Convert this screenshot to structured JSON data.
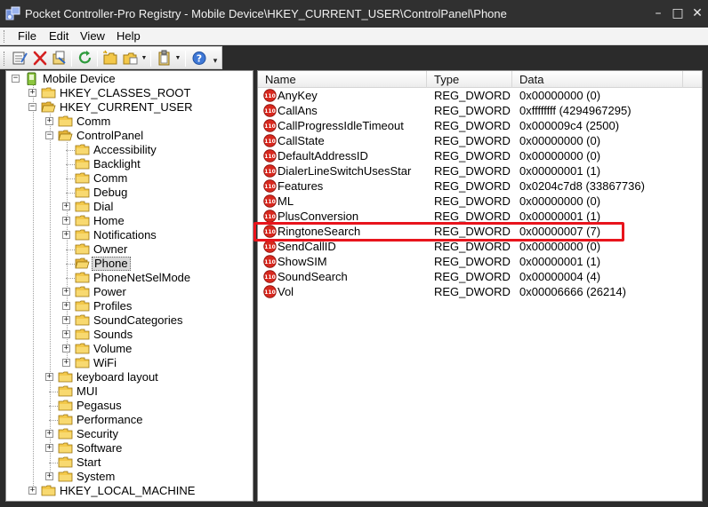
{
  "window": {
    "title": "Pocket Controller-Pro Registry - Mobile Device\\HKEY_CURRENT_USER\\ControlPanel\\Phone",
    "minimize_glyph": "–",
    "maximize_glyph": "□",
    "close_glyph": "✕"
  },
  "menu": {
    "items": [
      {
        "label": "File"
      },
      {
        "label": "Edit"
      },
      {
        "label": "View"
      },
      {
        "label": "Help"
      }
    ]
  },
  "toolbar": {
    "buttons": [
      {
        "name": "properties-icon"
      },
      {
        "name": "delete-icon"
      },
      {
        "name": "export-icon"
      },
      {
        "name": "refresh-icon"
      },
      {
        "name": "new-key-icon"
      },
      {
        "name": "new-value-icon"
      },
      {
        "name": "clipboard-icon"
      },
      {
        "name": "help-icon"
      }
    ]
  },
  "tree": {
    "nodes": [
      {
        "label": "Mobile Device",
        "expander": "−"
      },
      {
        "label": "HKEY_CLASSES_ROOT",
        "expander": "+"
      },
      {
        "label": "HKEY_CURRENT_USER",
        "expander": "−"
      },
      {
        "label": "Comm",
        "expander": "+"
      },
      {
        "label": "ControlPanel",
        "expander": "−"
      },
      {
        "label": "Accessibility",
        "expander": ""
      },
      {
        "label": "Backlight",
        "expander": ""
      },
      {
        "label": "Comm",
        "expander": ""
      },
      {
        "label": "Debug",
        "expander": ""
      },
      {
        "label": "Dial",
        "expander": "+"
      },
      {
        "label": "Home",
        "expander": "+"
      },
      {
        "label": "Notifications",
        "expander": "+"
      },
      {
        "label": "Owner",
        "expander": ""
      },
      {
        "label": "Phone",
        "expander": "",
        "selected": true
      },
      {
        "label": "PhoneNetSelMode",
        "expander": ""
      },
      {
        "label": "Power",
        "expander": "+"
      },
      {
        "label": "Profiles",
        "expander": "+"
      },
      {
        "label": "SoundCategories",
        "expander": "+"
      },
      {
        "label": "Sounds",
        "expander": "+"
      },
      {
        "label": "Volume",
        "expander": "+"
      },
      {
        "label": "WiFi",
        "expander": "+"
      },
      {
        "label": "keyboard layout",
        "expander": "+"
      },
      {
        "label": "MUI",
        "expander": ""
      },
      {
        "label": "Pegasus",
        "expander": ""
      },
      {
        "label": "Performance",
        "expander": ""
      },
      {
        "label": "Security",
        "expander": "+"
      },
      {
        "label": "Software",
        "expander": "+"
      },
      {
        "label": "Start",
        "expander": ""
      },
      {
        "label": "System",
        "expander": "+"
      },
      {
        "label": "HKEY_LOCAL_MACHINE",
        "expander": "+"
      }
    ]
  },
  "list": {
    "columns": [
      {
        "label": "Name"
      },
      {
        "label": "Type"
      },
      {
        "label": "Data"
      }
    ],
    "rows": [
      {
        "name": "AnyKey",
        "type": "REG_DWORD",
        "data": "0x00000000 (0)"
      },
      {
        "name": "CallAns",
        "type": "REG_DWORD",
        "data": "0xffffffff (4294967295)"
      },
      {
        "name": "CallProgressIdleTimeout",
        "type": "REG_DWORD",
        "data": "0x000009c4 (2500)"
      },
      {
        "name": "CallState",
        "type": "REG_DWORD",
        "data": "0x00000000 (0)"
      },
      {
        "name": "DefaultAddressID",
        "type": "REG_DWORD",
        "data": "0x00000000 (0)"
      },
      {
        "name": "DialerLineSwitchUsesStar",
        "type": "REG_DWORD",
        "data": "0x00000001 (1)"
      },
      {
        "name": "Features",
        "type": "REG_DWORD",
        "data": "0x0204c7d8 (33867736)"
      },
      {
        "name": "ML",
        "type": "REG_DWORD",
        "data": "0x00000000 (0)"
      },
      {
        "name": "PlusConversion",
        "type": "REG_DWORD",
        "data": "0x00000001 (1)"
      },
      {
        "name": "RingtoneSearch",
        "type": "REG_DWORD",
        "data": "0x00000007 (7)",
        "highlighted": true
      },
      {
        "name": "SendCallID",
        "type": "REG_DWORD",
        "data": "0x00000000 (0)"
      },
      {
        "name": "ShowSIM",
        "type": "REG_DWORD",
        "data": "0x00000001 (1)"
      },
      {
        "name": "SoundSearch",
        "type": "REG_DWORD",
        "data": "0x00000004 (4)"
      },
      {
        "name": "Vol",
        "type": "REG_DWORD",
        "data": "0x00006666 (26214)"
      }
    ],
    "value_icon_text": "110"
  },
  "colors": {
    "accent_highlight": "#e8141c",
    "selection": "#d9d9d9",
    "window_frame": "#2b2b2b",
    "folder": "#f3c84a"
  }
}
